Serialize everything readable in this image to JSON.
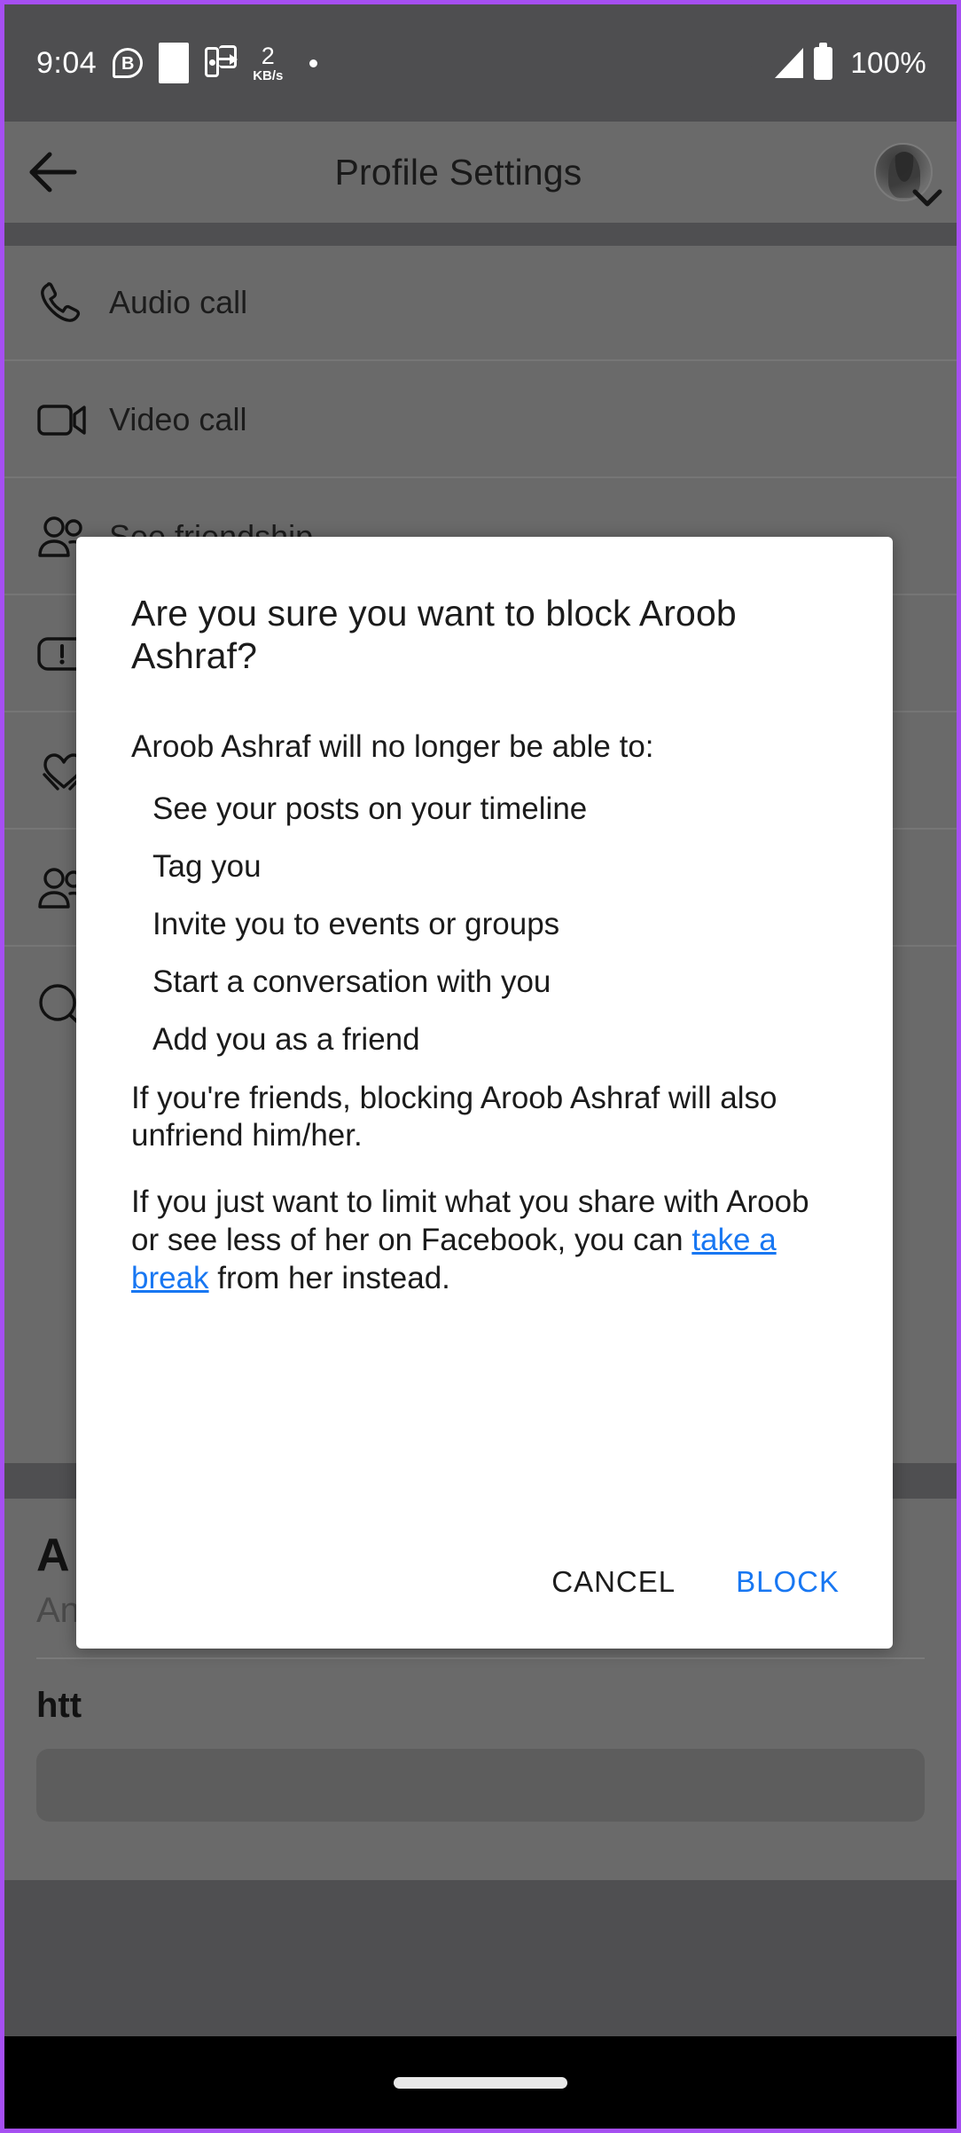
{
  "status_bar": {
    "time": "9:04",
    "battery_percent": "100%",
    "network_speed_value": "2",
    "network_speed_unit": "KB/s",
    "icons": [
      "bluetooth-b-icon",
      "white-square-icon",
      "cast-screen-icon",
      "data-speed-icon",
      "dot-icon",
      "location-icon",
      "signal-icon",
      "battery-icon"
    ]
  },
  "app_bar": {
    "title": "Profile Settings",
    "back_icon": "back-arrow-icon",
    "avatar_icon": "profile-avatar-icon",
    "avatar_chevron": "chevron-down-icon"
  },
  "background_list": {
    "rows": [
      {
        "label": "Audio call",
        "icon": "phone-icon"
      },
      {
        "label": "Video call",
        "icon": "video-camera-icon"
      },
      {
        "label": "See friendship",
        "icon": "people-icon"
      },
      {
        "label": "",
        "icon": "report-icon"
      },
      {
        "label": "",
        "icon": "heart-hands-icon"
      },
      {
        "label": "",
        "icon": "people-icon"
      },
      {
        "label": "",
        "icon": "search-icon"
      }
    ]
  },
  "background_card": {
    "title": "A",
    "subtitle": "An",
    "url": "htt"
  },
  "dialog": {
    "title": "Are you sure you want to block Aroob Ashraf?",
    "intro": "Aroob Ashraf will no longer be able to:",
    "capabilities": [
      "See your posts on your timeline",
      "Tag you",
      "Invite you to events or groups",
      "Start a conversation with you",
      "Add you as a friend"
    ],
    "paragraph_unfriend": "If you're friends, blocking Aroob Ashraf will also unfriend him/her.",
    "paragraph_limit_before": "If you just want to limit what you share with Aroob or see less of her on Facebook, you can ",
    "link_take_a_break": "take a break",
    "paragraph_limit_after": " from her instead.",
    "cancel_label": "CANCEL",
    "block_label": "BLOCK",
    "link_color": "#1877f2",
    "block_color": "#1877f2"
  },
  "nav_bar": {
    "home_indicator": "home-indicator"
  }
}
